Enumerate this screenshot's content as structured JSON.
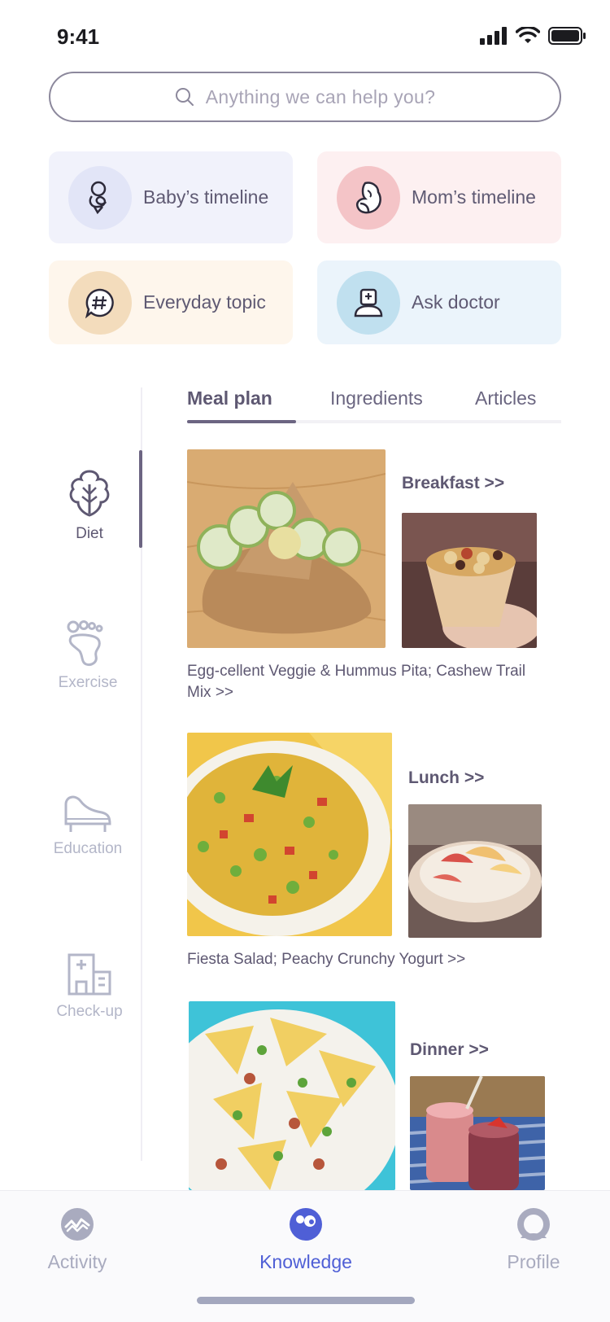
{
  "status": {
    "time": "9:41"
  },
  "search": {
    "placeholder": "Anything we can help you?"
  },
  "shortcuts": [
    {
      "label": "Baby’s timeline",
      "icon": "baby-icon",
      "bg": "#f1f2fb",
      "circle": "#e2e5f7"
    },
    {
      "label": "Mom’s timeline",
      "icon": "pregnant-mom-icon",
      "bg": "#fdf0f1",
      "circle": "#f4c4c7"
    },
    {
      "label": "Everyday topic",
      "icon": "hashtag-chat-icon",
      "bg": "#fef6ec",
      "circle": "#f3dcbc"
    },
    {
      "label": "Ask doctor",
      "icon": "doctor-icon",
      "bg": "#ebf4fb",
      "circle": "#c0e0ef"
    }
  ],
  "side_nav": [
    {
      "label": "Diet",
      "icon": "lettuce-icon",
      "active": true
    },
    {
      "label": "Exercise",
      "icon": "footprint-icon",
      "active": false
    },
    {
      "label": "Education",
      "icon": "piano-icon",
      "active": false
    },
    {
      "label": "Check-up",
      "icon": "hospital-icon",
      "active": false
    }
  ],
  "tabs": [
    {
      "label": "Meal plan",
      "active": true
    },
    {
      "label": "Ingredients",
      "active": false
    },
    {
      "label": "Articles",
      "active": false
    }
  ],
  "meals": [
    {
      "heading": "Breakfast >>",
      "description": "Egg-cellent Veggie & Hummus Pita; Cashew Trail Mix >>"
    },
    {
      "heading": "Lunch >>",
      "description": "Fiesta Salad; Peachy Crunchy Yogurt >>"
    },
    {
      "heading": "Dinner >>",
      "description": ""
    }
  ],
  "bottom_nav": [
    {
      "label": "Activity",
      "icon": "activity-icon",
      "active": false
    },
    {
      "label": "Knowledge",
      "icon": "knowledge-icon",
      "active": true
    },
    {
      "label": "Profile",
      "icon": "profile-icon",
      "active": false
    }
  ],
  "colors": {
    "accent": "#4f5fd6",
    "text": "#5e5872",
    "muted": "#a9abbf"
  }
}
